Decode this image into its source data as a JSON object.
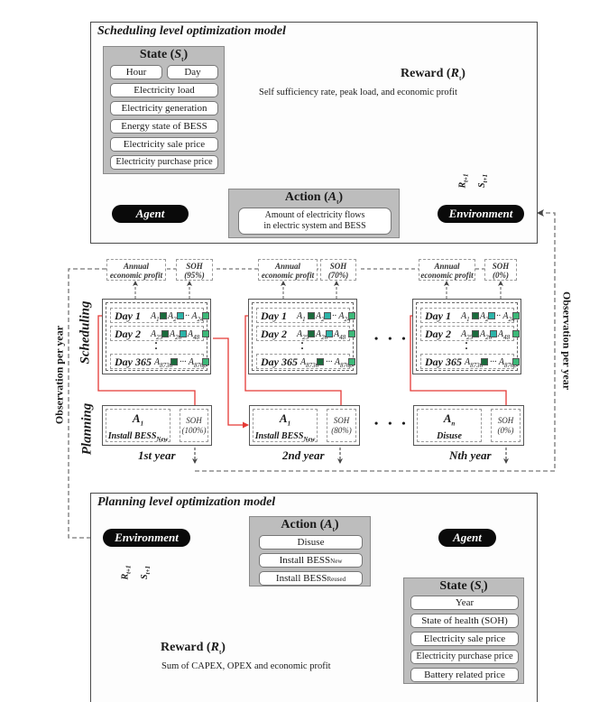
{
  "scheduling_model": {
    "title": "Scheduling level optimization model",
    "state": {
      "title_prefix": "State (",
      "title_var": "S",
      "title_sub": "t",
      "title_suffix": ")",
      "items_row": [
        "Hour",
        "Day"
      ],
      "items": [
        "Electricity load",
        "Electricity generation",
        "Energy state of BESS",
        "Electricity sale price",
        "Electricity purchase price"
      ]
    },
    "agent_label": "Agent",
    "environment_label": "Environment",
    "action": {
      "title_prefix": "Action (",
      "title_var": "A",
      "title_sub": "t",
      "title_suffix": ")",
      "description_line1": "Amount of electricity flows",
      "description_line2": "in electric system and BESS"
    },
    "reward": {
      "title_prefix": "Reward (",
      "title_var": "R",
      "title_sub": "t",
      "title_suffix": ")",
      "description": "Self sufficiency rate, peak load, and economic profit"
    },
    "feedback_labels": {
      "reward": "R",
      "reward_sub": "t+1",
      "state": "S",
      "state_sub": "t+1"
    }
  },
  "middle": {
    "side_labels": {
      "scheduling": "Scheduling",
      "planning": "Planning"
    },
    "observation_label": "Observation per year",
    "ellipsis": "• • •",
    "years": [
      {
        "year_label": "1st year",
        "annual_profit": [
          "Annual",
          "economic profit"
        ],
        "soh_top": [
          "SOH",
          "(95%)"
        ],
        "days": [
          {
            "label": "Day 1",
            "a1": "A",
            "a1_sub": "1",
            "a2": "A",
            "a2_sub": "2",
            "a3": "A",
            "a3_sub": "24"
          },
          {
            "label": "Day 2",
            "a1": "A",
            "a1_sub": "25",
            "a2": "A",
            "a2_sub": "26",
            "a3": "A",
            "a3_sub": "48"
          },
          {
            "label": "Day 365",
            "a1": "A",
            "a1_sub": "8736",
            "a3": "A",
            "a3_sub": "8760"
          }
        ],
        "plan_action": "A",
        "plan_action_sub": "1",
        "plan_desc": "Install BESS",
        "plan_desc_sub": "New",
        "soh_bottom": [
          "SOH",
          "(100%)"
        ]
      },
      {
        "year_label": "2nd year",
        "annual_profit": [
          "Annual",
          "economic profit"
        ],
        "soh_top": [
          "SOH",
          "(70%)"
        ],
        "days": [
          {
            "label": "Day 1",
            "a1": "A",
            "a1_sub": "1",
            "a2": "A",
            "a2_sub": "2",
            "a3": "A",
            "a3_sub": "24"
          },
          {
            "label": "Day 2",
            "a1": "A",
            "a1_sub": "25",
            "a2": "A",
            "a2_sub": "26",
            "a3": "A",
            "a3_sub": "48"
          },
          {
            "label": "Day 365",
            "a1": "A",
            "a1_sub": "8736",
            "a3": "A",
            "a3_sub": "8760"
          }
        ],
        "plan_action": "A",
        "plan_action_sub": "1",
        "plan_desc": "Install BESS",
        "plan_desc_sub": "New",
        "soh_bottom": [
          "SOH",
          "(80%)"
        ]
      },
      {
        "year_label": "Nth year",
        "annual_profit": [
          "Annual",
          "economic profit"
        ],
        "soh_top": [
          "SOH",
          "(0%)"
        ],
        "days": [
          {
            "label": "Day 1",
            "a1": "A",
            "a1_sub": "1",
            "a2": "A",
            "a2_sub": "2",
            "a3": "A",
            "a3_sub": "24"
          },
          {
            "label": "Day 2",
            "a1": "A",
            "a1_sub": "25",
            "a2": "A",
            "a2_sub": "26",
            "a3": "A",
            "a3_sub": "48"
          },
          {
            "label": "Day 365",
            "a1": "A",
            "a1_sub": "8736",
            "a3": "A",
            "a3_sub": "8760"
          }
        ],
        "plan_action": "A",
        "plan_action_sub": "n",
        "plan_desc": "Disuse",
        "plan_desc_sub": "",
        "soh_bottom": [
          "SOH",
          "(0%)"
        ]
      }
    ],
    "colors": {
      "dark_green": "#1a6b3c",
      "teal": "#2bb3a8",
      "light_green": "#3cb878",
      "red_arrow": "#e53935"
    }
  },
  "planning_model": {
    "title": "Planning level optimization model",
    "environment_label": "Environment",
    "agent_label": "Agent",
    "action": {
      "title_prefix": "Action (",
      "title_var": "A",
      "title_sub": "t",
      "title_suffix": ")",
      "items": [
        {
          "main": "Disuse",
          "sub": ""
        },
        {
          "main": "Install BESS",
          "sub": "New"
        },
        {
          "main": "Install BESS",
          "sub": "Reused"
        }
      ]
    },
    "state": {
      "title_prefix": "State (",
      "title_var": "S",
      "title_sub": "t",
      "title_suffix": ")",
      "items": [
        "Year",
        "State of health (SOH)",
        "Electricity sale price",
        "Electricity purchase price",
        "Battery related price"
      ]
    },
    "reward": {
      "title_prefix": "Reward (",
      "title_var": "R",
      "title_sub": "t",
      "title_suffix": ")",
      "description": "Sum of CAPEX, OPEX and economic profit"
    },
    "feedback_labels": {
      "reward": "R",
      "reward_sub": "t+1",
      "state": "S",
      "state_sub": "t+1"
    }
  }
}
